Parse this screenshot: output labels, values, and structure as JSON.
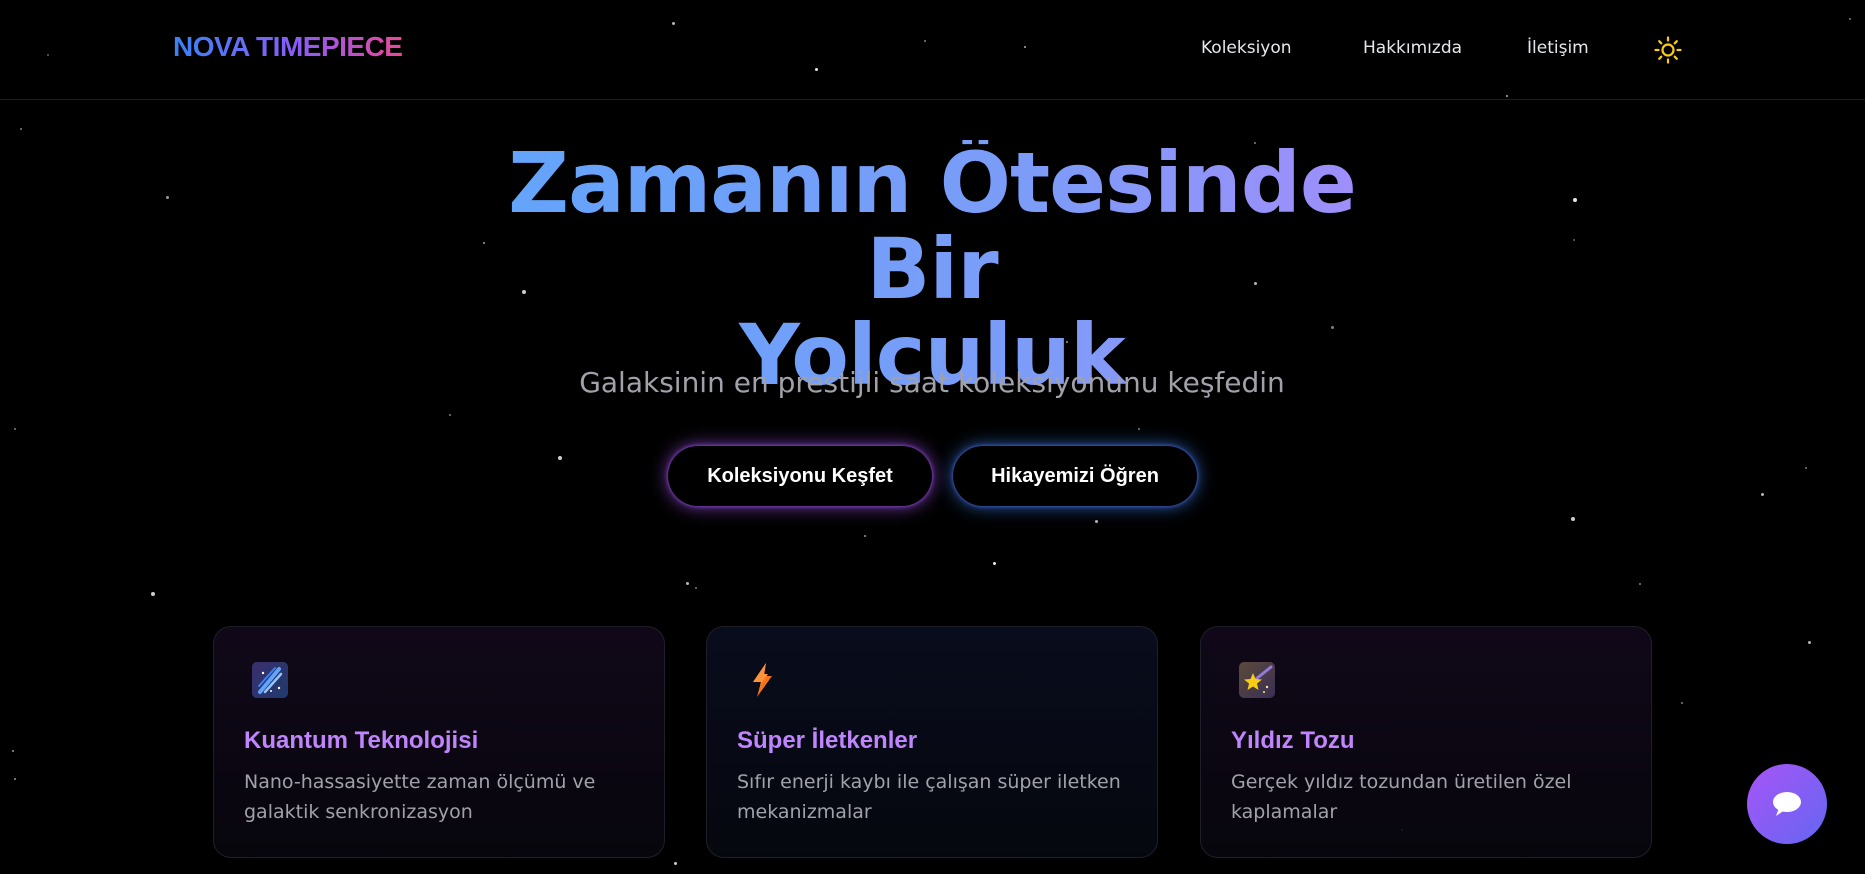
{
  "header": {
    "logo": "NOVA TIMEPIECE",
    "nav": [
      {
        "label": "Koleksiyon"
      },
      {
        "label": "Hakkımızda"
      },
      {
        "label": "İletişim"
      }
    ]
  },
  "hero": {
    "title_line1": "Zamanın Ötesinde Bir",
    "title_line2": "Yolculuk",
    "subtitle": "Galaksinin en prestijli saat koleksiyonunu keşfedin",
    "primary_button": "Koleksiyonu Keşfet",
    "secondary_button": "Hikayemizi Öğren"
  },
  "features": [
    {
      "title": "Kuantum Teknolojisi",
      "desc": "Nano-hassasiyette zaman ölçümü ve galaktik senkronizasyon",
      "icon": "comet-icon"
    },
    {
      "title": "Süper İletkenler",
      "desc": "Sıfır enerji kaybı ile çalışan süper iletken mekanizmalar",
      "icon": "lightning-icon"
    },
    {
      "title": "Yıldız Tozu",
      "desc": "Gerçek yıldız tozundan üretilen özel kaplamalar",
      "icon": "shooting-star-icon"
    }
  ],
  "colors": {
    "accent_purple": "#c084fc",
    "accent_blue": "#60a5fa",
    "logo_pink": "#ec4899",
    "sun": "#facc15"
  }
}
